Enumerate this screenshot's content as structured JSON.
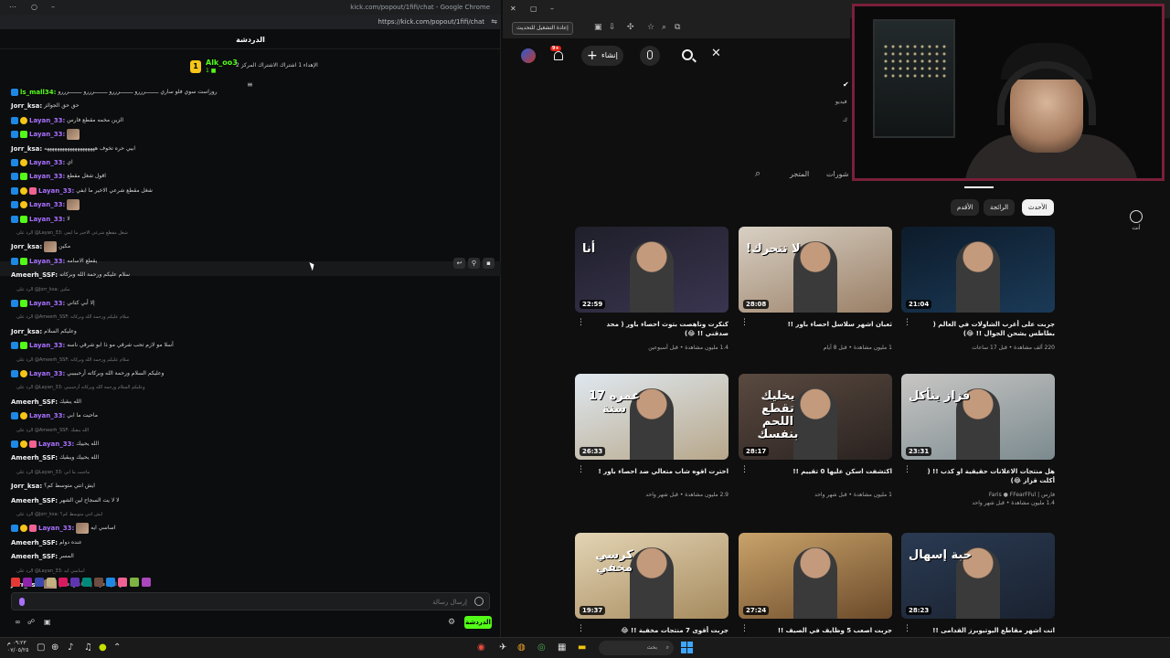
{
  "left_window": {
    "title": "kick.com/popout/1fifi/chat - Google Chrome",
    "url": "https://kick.com/popout/1fifi/chat",
    "chat_header": "الدردشة",
    "pinned": {
      "coin": "1",
      "name": "Alk_oo3",
      "sub": "1 ■",
      "message": "الإهداء 1 اشتراك الاشتراك المركز 2"
    },
    "messages": [
      {
        "user": "ls_mall34:",
        "text": "روزاست سوي فلو ساري ــــــــرررو ــــــــرررو ــــــــرررو ــــــــرررو",
        "color": "green"
      },
      {
        "user": "Jorr_ksa:",
        "text": "حق حق الجوائز",
        "color": "white"
      },
      {
        "user": "Layan_33:",
        "text": "الزين مخمه مقطع فارس",
        "color": "purple"
      },
      {
        "user": "Layan_33:",
        "text": "",
        "color": "purple",
        "thumb": true
      },
      {
        "user": "Jorr_ksa:",
        "text": "ابيي حره تخوف ههههههههههههههههههههه",
        "color": "white"
      },
      {
        "user": "Layan_33:",
        "text": "اي",
        "color": "purple"
      },
      {
        "user": "Layan_33:",
        "text": "اقول شغل مقطع",
        "color": "purple"
      },
      {
        "user": "Layan_33:",
        "text": "شغل مقطع شرعي الاخير ما ابفي",
        "color": "purple"
      },
      {
        "user": "Layan_33:",
        "text": "",
        "color": "purple",
        "thumb": true
      },
      {
        "user": "Layan_33:",
        "text": "لا",
        "color": "purple"
      },
      {
        "user": "",
        "text": "الرد على @Layan_33: شغل مقطع شرعي الاخير ما ابفي",
        "color": "reply"
      },
      {
        "user": "Jorr_ksa:",
        "text": "مكين",
        "color": "white",
        "thumb": true
      },
      {
        "user": "Layan_33:",
        "text": "يقطع الاسامه",
        "color": "purple"
      },
      {
        "user": "Ameerh_SSF:",
        "text": "سلام عليكم ورحمة الله وبركاته",
        "color": "white"
      },
      {
        "user": "",
        "text": "الرد على @Jorr_ksa: مكين",
        "color": "reply"
      },
      {
        "user": "Layan_33:",
        "text": "إلا أبي كتاني",
        "color": "purple"
      },
      {
        "user": "",
        "text": "الرد على @Ameerh_SSF: سلام عليكم ورحمة الله وبركاته",
        "color": "reply"
      },
      {
        "user": "Jorr_ksa:",
        "text": "وعليكم السلام",
        "color": "white"
      },
      {
        "user": "Layan_33:",
        "text": "أسلا مو لازم تحب شرقي مو ذا ابو شرقي ناسه",
        "color": "purple"
      },
      {
        "user": "",
        "text": "الرد على @Ameerh_SSF: سلام عليكم ورحمة الله وبركاته",
        "color": "reply"
      },
      {
        "user": "Layan_33:",
        "text": "وعليكم السلام ورحمة الله وبركاته أرحببببي",
        "color": "purple"
      },
      {
        "user": "",
        "text": "الرد على @Layan_33: وعليكم السلام ورحمة الله وبركاته أرحببببي",
        "color": "reply"
      },
      {
        "user": "Ameerh_SSF:",
        "text": "الله يبقيك",
        "color": "white"
      },
      {
        "user": "Layan_33:",
        "text": "ماحيت ما ابي",
        "color": "purple"
      },
      {
        "user": "",
        "text": "الرد على @Ameerh_SSF: الله يبقيك",
        "color": "reply"
      },
      {
        "user": "Layan_33:",
        "text": "الله يحييك",
        "color": "purple"
      },
      {
        "user": "Ameerh_SSF:",
        "text": "الله يحييك ويبقيك",
        "color": "white"
      },
      {
        "user": "",
        "text": "الرد على @Layan_33: ماحيت ما ابي",
        "color": "reply"
      },
      {
        "user": "Jorr_ksa:",
        "text": "ايش انتي متوسط كم؟",
        "color": "white"
      },
      {
        "user": "Ameerh_SSF:",
        "text": "لا لا يت السجاح لين الشهر",
        "color": "white"
      },
      {
        "user": "",
        "text": "الرد على @Jorr_ksa: ايش انتي متوسط كم؟",
        "color": "reply"
      },
      {
        "user": "Layan_33:",
        "text": "اساسي ايه",
        "color": "purple",
        "thumb": true
      },
      {
        "user": "Ameerh_SSF:",
        "text": "عنده دوام",
        "color": "white"
      },
      {
        "user": "Ameerh_SSF:",
        "text": "المسر",
        "color": "white"
      },
      {
        "user": "",
        "text": "الرد على @Layan_33: اساسي ايه",
        "color": "reply"
      },
      {
        "user": "Jorr_ksa:",
        "text": "بس اني اعرف إلا ماعين عادي",
        "color": "white",
        "thumb": true
      },
      {
        "user": "",
        "text": "الرد على @Jorr_ksa: بس اني اعرف إلا ماعين عادي",
        "color": "reply",
        "thumb": true
      },
      {
        "user": "Layan_33:",
        "text": "ثاني",
        "color": "purple"
      },
      {
        "user": "",
        "text": "الرد على @Layan_33: ثاني",
        "color": "reply"
      },
      {
        "user": "Jorr_ksa:",
        "text": "ايكيبي الله يرفقك",
        "color": "white"
      }
    ],
    "input_placeholder": "إرسال رسالة",
    "send_label": "الدردشة"
  },
  "right_window": {
    "update_button": "إعادة التشغيل للتحديث",
    "create_button": "إنشاء",
    "notif_count": "9+",
    "search_value": "",
    "channel_lines": [
      "فيديو",
      "ك"
    ],
    "tabs": [
      "المتجر",
      "شورات"
    ],
    "filters": [
      "الأحدث",
      "الرائجة",
      "الأقدم"
    ],
    "side_label": "أنت",
    "videos": [
      {
        "title": "جربت على أغرب الشاولات في العالم ( بطاطس يشحن الجوال !! 😂)",
        "meta1": "220 ألف مشاهدة • قبل 17 ساعات",
        "meta2": "",
        "duration": "21:04",
        "thumb_text": "",
        "thumb_colors": [
          "#0d1b2a",
          "#1b3a57"
        ]
      },
      {
        "title": "ثعبان اشهر سلاسل احصاء باور !!",
        "meta1": "1 مليون مشاهدة • قبل 8 أيام",
        "meta2": "",
        "duration": "28:08",
        "thumb_text": "لا تتحرك!",
        "thumb_colors": [
          "#d8d0c4",
          "#9a7f66"
        ]
      },
      {
        "title": "كنكرت وناهصت بتوث احصاء باور ( محد صدقني !! 😂)",
        "meta1": "1.4 مليون مشاهدة • قبل أسبوعين",
        "meta2": "",
        "duration": "22:59",
        "thumb_text": "أنا",
        "thumb_colors": [
          "#1f1f2a",
          "#3a3550"
        ]
      },
      {
        "title": "هل منتجات الاعلانات حقيقية او كذب !! ( أكلت قزاز 😂)",
        "meta1": "فارس | Faris ● FFearFFul",
        "meta2": "1.4 مليون مشاهدة • قبل شهر واحد",
        "duration": "23:31",
        "thumb_text": "قزاز ينأكل",
        "thumb_colors": [
          "#c8c6c4",
          "#7b8a8f"
        ]
      },
      {
        "title": "اكتشفت اسكن عليها 0 تقييم !!",
        "meta1": "1 مليون مشاهدة • قبل شهر واحد",
        "meta2": "",
        "duration": "28:17",
        "thumb_text": "يخليك تقطع اللحم بنفسك",
        "thumb_colors": [
          "#5a4a40",
          "#2a2220"
        ]
      },
      {
        "title": "اخترت اقوه شاب متعالي ضد احصاء باور !",
        "meta1": "2.9 مليون مشاهدة • قبل شهر واحد",
        "meta2": "",
        "duration": "26:33",
        "thumb_text": "عمره 17 سنة",
        "thumb_colors": [
          "#dfe8f0",
          "#b7a78a"
        ]
      },
      {
        "title": "اتت اشهر مقاطع اليوتيوبرز القدامى !!",
        "meta1": "",
        "meta2": "",
        "duration": "28:23",
        "thumb_text": "حبة إسهال",
        "thumb_colors": [
          "#2a3a52",
          "#1a2230"
        ]
      },
      {
        "title": "جربت اصعب 5 وظايف في الصيف !!",
        "meta1": "",
        "meta2": "",
        "duration": "27:24",
        "thumb_text": "",
        "thumb_colors": [
          "#c9a36a",
          "#6b4a2a"
        ]
      },
      {
        "title": "جربت أقوى 7 منتجات مخفية !! 😂",
        "meta1": "",
        "meta2": "",
        "duration": "19:37",
        "thumb_text": "كرسي مخفي",
        "thumb_colors": [
          "#e3d4b4",
          "#a68a5e"
        ]
      }
    ]
  },
  "taskbar": {
    "search": "بحث",
    "time": "٠٩:٢٣ م",
    "date": "٠٧/٠٥/٢٥"
  }
}
